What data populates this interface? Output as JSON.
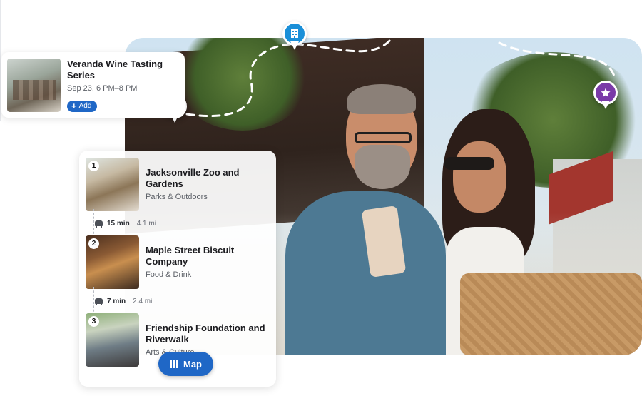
{
  "event_card": {
    "title": "Veranda Wine Tasting Series",
    "date": "Sep 23, 6 PM–8 PM",
    "add_label": "Add"
  },
  "itinerary": {
    "stops": [
      {
        "number": "1",
        "name": "Jacksonville Zoo and Gardens",
        "category": "Parks & Outdoors"
      },
      {
        "number": "2",
        "name": "Maple Street Biscuit Company",
        "category": "Food & Drink"
      },
      {
        "number": "3",
        "name": "Friendship Foundation and Riverwalk",
        "category": "Arts & Culture"
      }
    ],
    "legs": [
      {
        "time": "15 min",
        "distance": "4.1 mi"
      },
      {
        "time": "7 min",
        "distance": "2.4 mi"
      }
    ],
    "map_button_label": "Map"
  },
  "pins": {
    "hotel": {
      "icon": "building-icon",
      "color": "#1a8fd8"
    },
    "event": {
      "icon": "calendar-icon",
      "color": "#e0821f"
    },
    "favorite": {
      "icon": "star-icon",
      "color": "#7a3aa8"
    }
  },
  "colors": {
    "accent": "#1f67c6"
  }
}
